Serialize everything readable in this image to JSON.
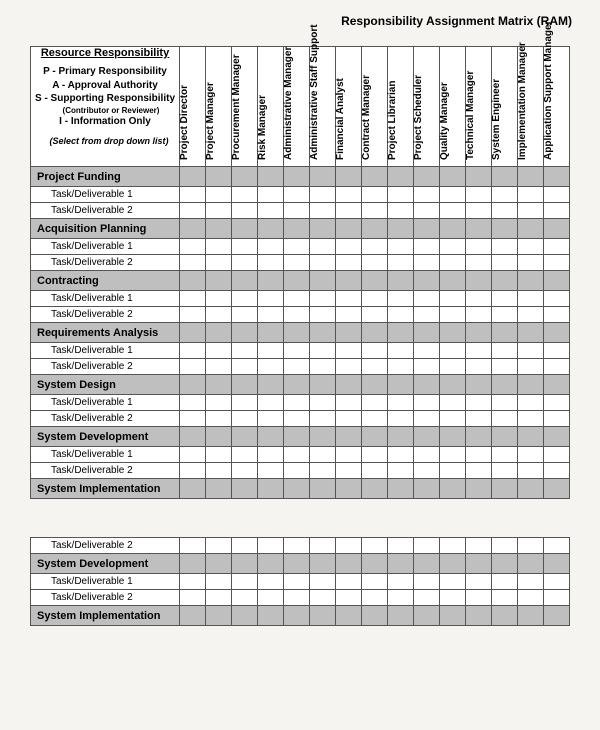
{
  "title": "Responsibility Assignment Matrix (RAM)",
  "legend": {
    "heading": "Resource Responsibility",
    "p": "P - Primary Responsibility",
    "a": "A - Approval Authority",
    "s": "S - Supporting Responsibility",
    "s_sub": "(Contributor or Reviewer)",
    "i": "I - Information Only",
    "note": "(Select from drop down list)"
  },
  "roles": [
    "Project Director",
    "Project Manager",
    "Procurement Manager",
    "Risk Manager",
    "Administrative Manager",
    "Administrative Staff Support",
    "Financial Analyst",
    "Contract Manager",
    "Project Librarian",
    "Project Scheduler",
    "Quality Manager",
    "Technical Manager",
    "System Engineer",
    "Implementation Manager",
    "Application Support Manager"
  ],
  "sections_top": [
    {
      "name": "Project Funding",
      "tasks": [
        "Task/Deliverable 1",
        "Task/Deliverable 2"
      ]
    },
    {
      "name": "Acquisition Planning",
      "tasks": [
        "Task/Deliverable 1",
        "Task/Deliverable 2"
      ]
    },
    {
      "name": "Contracting",
      "tasks": [
        "Task/Deliverable 1",
        "Task/Deliverable 2"
      ]
    },
    {
      "name": "Requirements Analysis",
      "tasks": [
        "Task/Deliverable 1",
        "Task/Deliverable 2"
      ]
    },
    {
      "name": "System Design",
      "tasks": [
        "Task/Deliverable 1",
        "Task/Deliverable 2"
      ]
    },
    {
      "name": "System Development",
      "tasks": [
        "Task/Deliverable 1",
        "Task/Deliverable 2"
      ]
    },
    {
      "name": "System Implementation",
      "tasks": []
    }
  ],
  "sections_bottom": [
    {
      "name": null,
      "tasks": [
        "Task/Deliverable 2"
      ]
    },
    {
      "name": "System Development",
      "tasks": [
        "Task/Deliverable 1",
        "Task/Deliverable 2"
      ]
    },
    {
      "name": "System Implementation",
      "tasks": []
    }
  ]
}
